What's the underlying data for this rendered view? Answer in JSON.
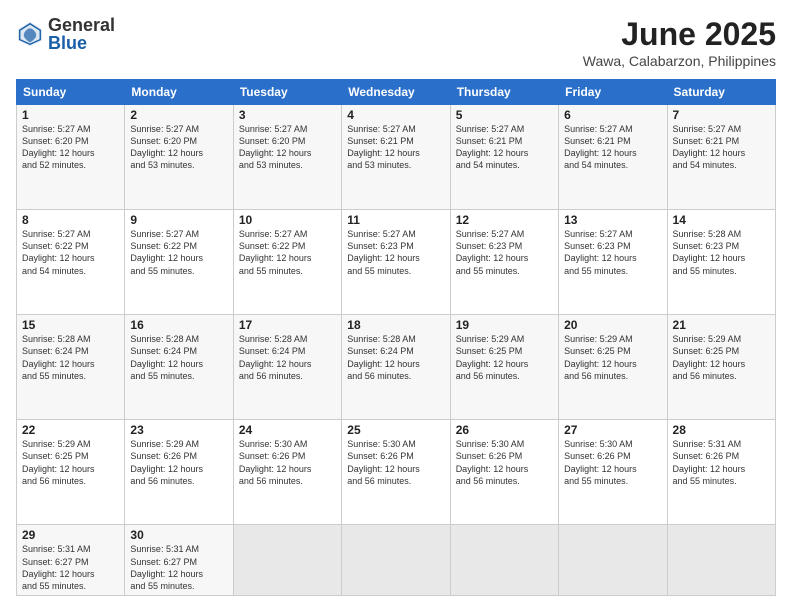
{
  "logo": {
    "general": "General",
    "blue": "Blue"
  },
  "title": "June 2025",
  "location": "Wawa, Calabarzon, Philippines",
  "headers": [
    "Sunday",
    "Monday",
    "Tuesday",
    "Wednesday",
    "Thursday",
    "Friday",
    "Saturday"
  ],
  "weeks": [
    [
      {
        "day": "1",
        "info": "Sunrise: 5:27 AM\nSunset: 6:20 PM\nDaylight: 12 hours\nand 52 minutes."
      },
      {
        "day": "2",
        "info": "Sunrise: 5:27 AM\nSunset: 6:20 PM\nDaylight: 12 hours\nand 53 minutes."
      },
      {
        "day": "3",
        "info": "Sunrise: 5:27 AM\nSunset: 6:20 PM\nDaylight: 12 hours\nand 53 minutes."
      },
      {
        "day": "4",
        "info": "Sunrise: 5:27 AM\nSunset: 6:21 PM\nDaylight: 12 hours\nand 53 minutes."
      },
      {
        "day": "5",
        "info": "Sunrise: 5:27 AM\nSunset: 6:21 PM\nDaylight: 12 hours\nand 54 minutes."
      },
      {
        "day": "6",
        "info": "Sunrise: 5:27 AM\nSunset: 6:21 PM\nDaylight: 12 hours\nand 54 minutes."
      },
      {
        "day": "7",
        "info": "Sunrise: 5:27 AM\nSunset: 6:21 PM\nDaylight: 12 hours\nand 54 minutes."
      }
    ],
    [
      {
        "day": "8",
        "info": "Sunrise: 5:27 AM\nSunset: 6:22 PM\nDaylight: 12 hours\nand 54 minutes."
      },
      {
        "day": "9",
        "info": "Sunrise: 5:27 AM\nSunset: 6:22 PM\nDaylight: 12 hours\nand 55 minutes."
      },
      {
        "day": "10",
        "info": "Sunrise: 5:27 AM\nSunset: 6:22 PM\nDaylight: 12 hours\nand 55 minutes."
      },
      {
        "day": "11",
        "info": "Sunrise: 5:27 AM\nSunset: 6:23 PM\nDaylight: 12 hours\nand 55 minutes."
      },
      {
        "day": "12",
        "info": "Sunrise: 5:27 AM\nSunset: 6:23 PM\nDaylight: 12 hours\nand 55 minutes."
      },
      {
        "day": "13",
        "info": "Sunrise: 5:27 AM\nSunset: 6:23 PM\nDaylight: 12 hours\nand 55 minutes."
      },
      {
        "day": "14",
        "info": "Sunrise: 5:28 AM\nSunset: 6:23 PM\nDaylight: 12 hours\nand 55 minutes."
      }
    ],
    [
      {
        "day": "15",
        "info": "Sunrise: 5:28 AM\nSunset: 6:24 PM\nDaylight: 12 hours\nand 55 minutes."
      },
      {
        "day": "16",
        "info": "Sunrise: 5:28 AM\nSunset: 6:24 PM\nDaylight: 12 hours\nand 55 minutes."
      },
      {
        "day": "17",
        "info": "Sunrise: 5:28 AM\nSunset: 6:24 PM\nDaylight: 12 hours\nand 56 minutes."
      },
      {
        "day": "18",
        "info": "Sunrise: 5:28 AM\nSunset: 6:24 PM\nDaylight: 12 hours\nand 56 minutes."
      },
      {
        "day": "19",
        "info": "Sunrise: 5:29 AM\nSunset: 6:25 PM\nDaylight: 12 hours\nand 56 minutes."
      },
      {
        "day": "20",
        "info": "Sunrise: 5:29 AM\nSunset: 6:25 PM\nDaylight: 12 hours\nand 56 minutes."
      },
      {
        "day": "21",
        "info": "Sunrise: 5:29 AM\nSunset: 6:25 PM\nDaylight: 12 hours\nand 56 minutes."
      }
    ],
    [
      {
        "day": "22",
        "info": "Sunrise: 5:29 AM\nSunset: 6:25 PM\nDaylight: 12 hours\nand 56 minutes."
      },
      {
        "day": "23",
        "info": "Sunrise: 5:29 AM\nSunset: 6:26 PM\nDaylight: 12 hours\nand 56 minutes."
      },
      {
        "day": "24",
        "info": "Sunrise: 5:30 AM\nSunset: 6:26 PM\nDaylight: 12 hours\nand 56 minutes."
      },
      {
        "day": "25",
        "info": "Sunrise: 5:30 AM\nSunset: 6:26 PM\nDaylight: 12 hours\nand 56 minutes."
      },
      {
        "day": "26",
        "info": "Sunrise: 5:30 AM\nSunset: 6:26 PM\nDaylight: 12 hours\nand 56 minutes."
      },
      {
        "day": "27",
        "info": "Sunrise: 5:30 AM\nSunset: 6:26 PM\nDaylight: 12 hours\nand 55 minutes."
      },
      {
        "day": "28",
        "info": "Sunrise: 5:31 AM\nSunset: 6:26 PM\nDaylight: 12 hours\nand 55 minutes."
      }
    ],
    [
      {
        "day": "29",
        "info": "Sunrise: 5:31 AM\nSunset: 6:27 PM\nDaylight: 12 hours\nand 55 minutes."
      },
      {
        "day": "30",
        "info": "Sunrise: 5:31 AM\nSunset: 6:27 PM\nDaylight: 12 hours\nand 55 minutes."
      },
      {
        "day": "",
        "info": ""
      },
      {
        "day": "",
        "info": ""
      },
      {
        "day": "",
        "info": ""
      },
      {
        "day": "",
        "info": ""
      },
      {
        "day": "",
        "info": ""
      }
    ]
  ]
}
